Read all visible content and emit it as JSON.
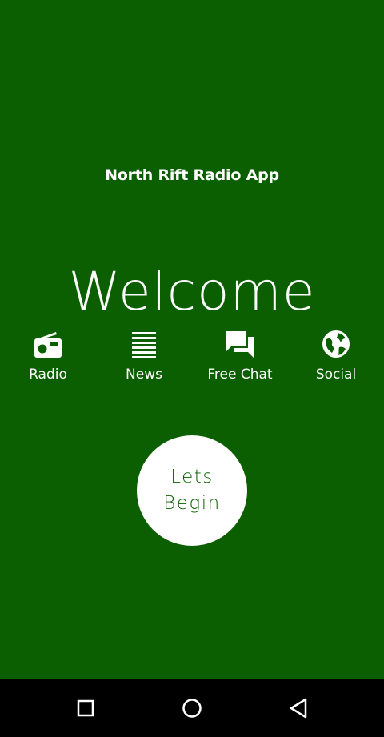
{
  "app": {
    "title": "North Rift Radio App",
    "welcome": "Welcome"
  },
  "nav": {
    "items": [
      {
        "label": "Radio",
        "icon": "radio-icon"
      },
      {
        "label": "News",
        "icon": "list-icon"
      },
      {
        "label": "Free Chat",
        "icon": "chat-icon"
      },
      {
        "label": "Social",
        "icon": "globe-icon"
      }
    ]
  },
  "cta": {
    "label": "Lets\nBegin"
  },
  "system_nav": {
    "recents": "square-icon",
    "home": "circle-icon",
    "back": "triangle-back-icon"
  },
  "colors": {
    "background": "#0b5f00",
    "text": "#ffffff",
    "system_bar": "#000000"
  }
}
